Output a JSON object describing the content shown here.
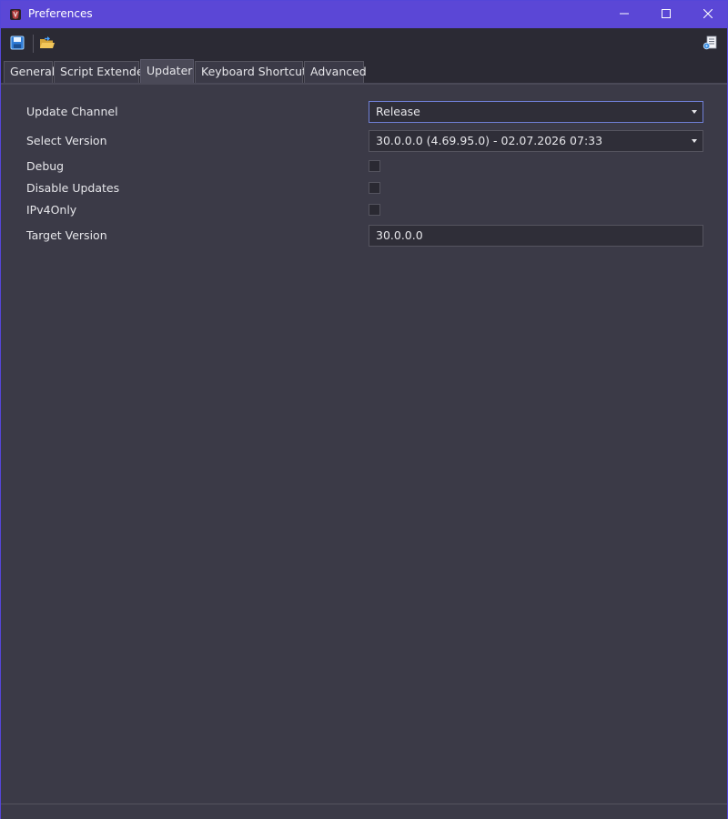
{
  "window": {
    "title": "Preferences",
    "accent_color": "#5b47d6",
    "app_icon": "app-logo-icon",
    "controls": [
      "minimize-icon",
      "maximize-icon",
      "close-icon"
    ]
  },
  "toolbar": {
    "buttons": [
      "save-icon",
      "open-folder-icon",
      "document-settings-icon"
    ]
  },
  "tabs": [
    {
      "label": "General"
    },
    {
      "label": "Script Extender"
    },
    {
      "label": "Updater",
      "active": true
    },
    {
      "label": "Keyboard Shortcuts"
    },
    {
      "label": "Advanced"
    }
  ],
  "updater": {
    "update_channel": {
      "label": "Update Channel",
      "value": "Release"
    },
    "select_version": {
      "label": "Select Version",
      "value": "30.0.0.0 (4.69.95.0) - 02.07.2026 07:33"
    },
    "debug": {
      "label": "Debug",
      "checked": false
    },
    "disable_updates": {
      "label": "Disable Updates",
      "checked": false
    },
    "ipv4only": {
      "label": "IPv4Only",
      "checked": false
    },
    "target_version": {
      "label": "Target Version",
      "value": "30.0.0.0"
    }
  }
}
